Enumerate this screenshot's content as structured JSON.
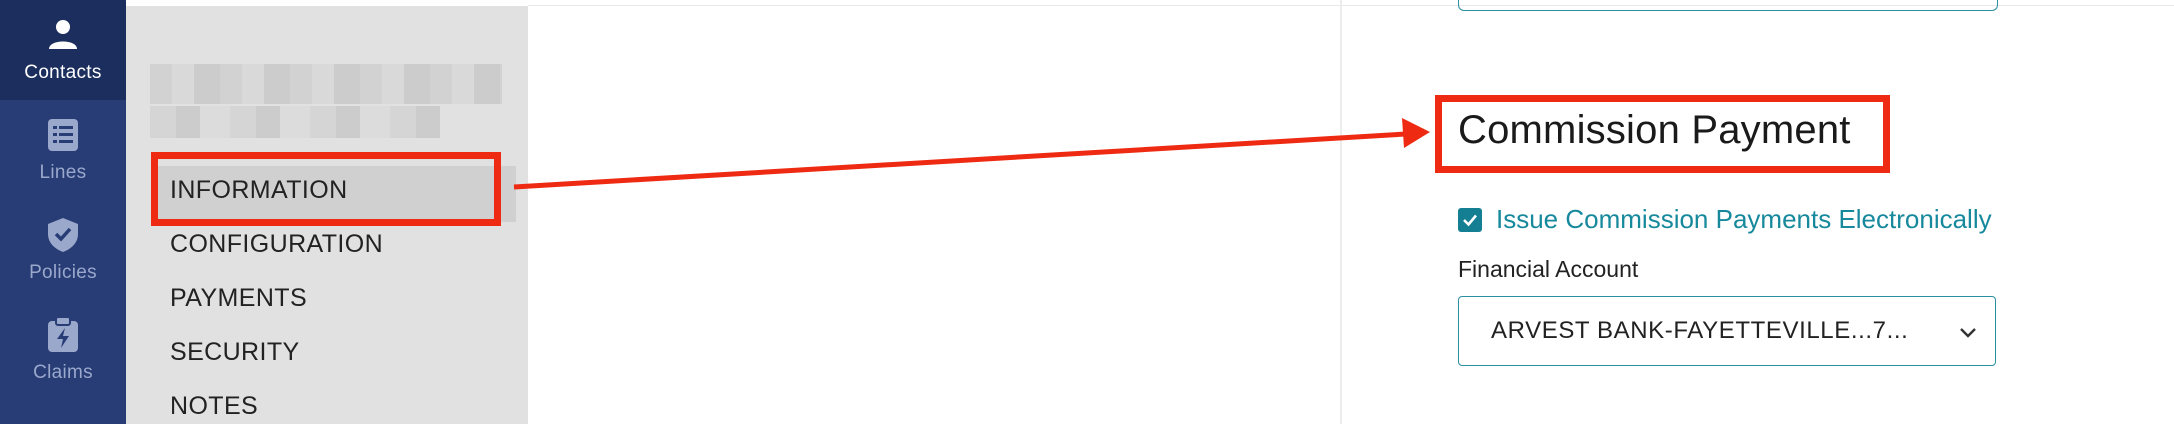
{
  "nav_rail": {
    "items": [
      {
        "label": "Contacts",
        "icon": "person-icon",
        "active": true
      },
      {
        "label": "Lines",
        "icon": "list-icon",
        "active": false
      },
      {
        "label": "Policies",
        "icon": "shield-check-icon",
        "active": false
      },
      {
        "label": "Claims",
        "icon": "clipboard-bolt-icon",
        "active": false
      }
    ]
  },
  "subnav": {
    "items": [
      {
        "label": "INFORMATION",
        "active": true
      },
      {
        "label": "CONFIGURATION",
        "active": false
      },
      {
        "label": "PAYMENTS",
        "active": false
      },
      {
        "label": "SECURITY",
        "active": false
      },
      {
        "label": "NOTES",
        "active": false
      }
    ]
  },
  "main": {
    "section_title": "Commission Payment",
    "checkbox_label": "Issue Commission Payments Electronically",
    "checkbox_checked": true,
    "financial_account_label": "Financial Account",
    "financial_account_value": "ARVEST BANK-FAYETTEVILLE...7..."
  },
  "annotation": {
    "color": "#ee2a12"
  },
  "colors": {
    "rail_bg": "#283d75",
    "rail_active_bg": "#1c2e5e",
    "accent_teal": "#17899c"
  }
}
